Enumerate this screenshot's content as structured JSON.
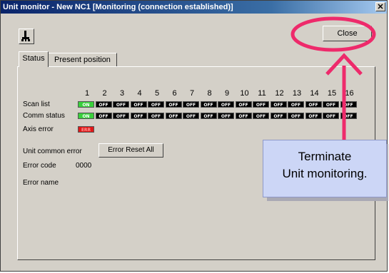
{
  "window": {
    "title": "Unit monitor - New NC1 [Monitoring (connection established)]",
    "close_glyph": "✕"
  },
  "toolbar": {
    "close_label": "Close",
    "icon": "unit-icon"
  },
  "tabs": [
    {
      "label": "Status",
      "active": true
    },
    {
      "label": "Present position",
      "active": false
    }
  ],
  "status": {
    "numbers": [
      "1",
      "2",
      "3",
      "4",
      "5",
      "6",
      "7",
      "8",
      "9",
      "10",
      "11",
      "12",
      "13",
      "14",
      "15",
      "16"
    ],
    "rows": [
      {
        "label": "Scan list",
        "indicators": [
          "ON",
          "OFF",
          "OFF",
          "OFF",
          "OFF",
          "OFF",
          "OFF",
          "OFF",
          "OFF",
          "OFF",
          "OFF",
          "OFF",
          "OFF",
          "OFF",
          "OFF",
          "OFF"
        ]
      },
      {
        "label": "Comm status",
        "indicators": [
          "ON",
          "OFF",
          "OFF",
          "OFF",
          "OFF",
          "OFF",
          "OFF",
          "OFF",
          "OFF",
          "OFF",
          "OFF",
          "OFF",
          "OFF",
          "OFF",
          "OFF",
          "OFF"
        ]
      },
      {
        "label": "Axis error",
        "indicators": [
          "ERR"
        ]
      }
    ],
    "unit_common_error_label": "Unit common error",
    "reset_button_label": "Error Reset All",
    "error_code_label": "Error code",
    "error_code_value": "0000",
    "error_name_label": "Error name"
  },
  "callout": {
    "line1": "Terminate",
    "line2": "Unit monitoring."
  },
  "colors": {
    "annotation": "#ee2a6b",
    "on": "#39d03b",
    "error": "#e01818",
    "callout_bg": "#ccd6f6"
  }
}
